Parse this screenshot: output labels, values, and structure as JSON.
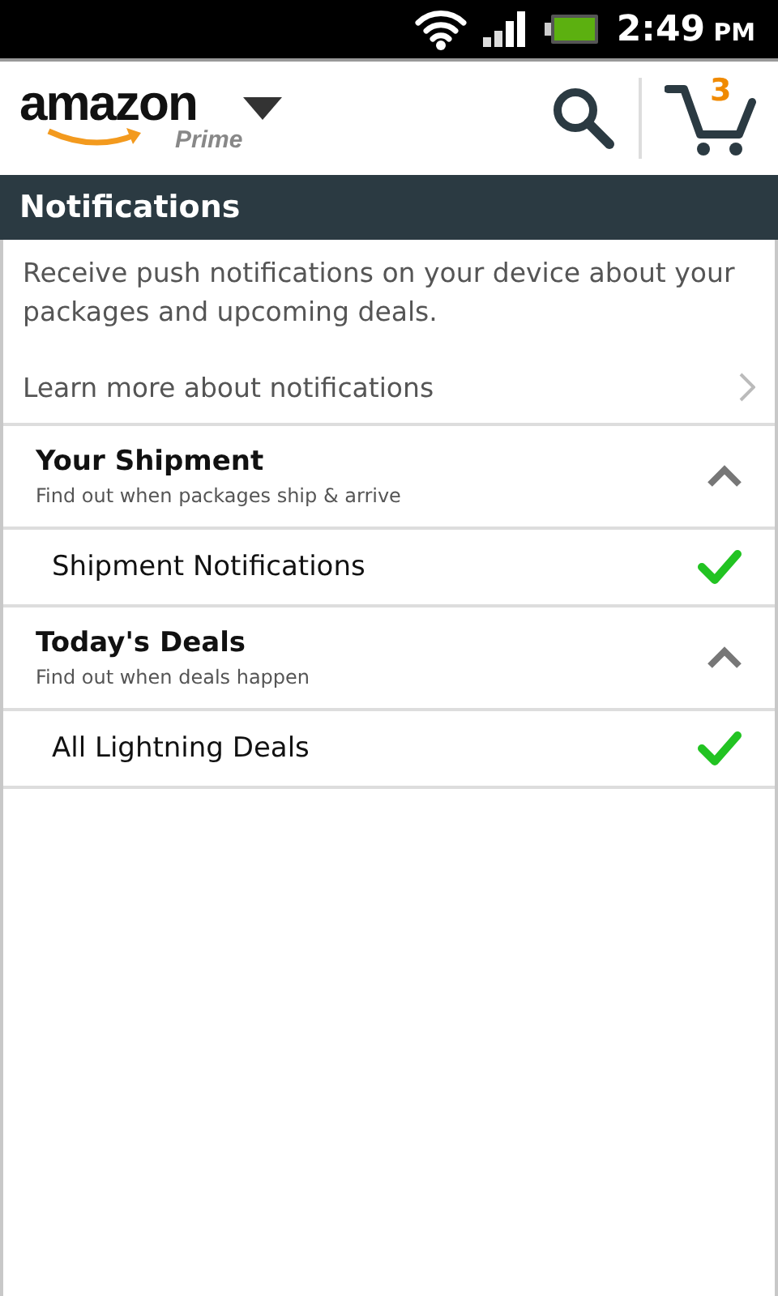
{
  "status_bar": {
    "time": "2:49",
    "ampm": "PM"
  },
  "header": {
    "logo": "amazon",
    "logo_sub": "Prime",
    "cart_count": "3"
  },
  "title": "Notifications",
  "description": "Receive push notifications on your device about your packages and upcoming deals.",
  "learn_more": "Learn more about notifications",
  "sections": [
    {
      "title": "Your Shipment",
      "subtitle": "Find out when packages ship & arrive",
      "expanded": true,
      "items": [
        {
          "label": "Shipment Notifications",
          "checked": true
        }
      ]
    },
    {
      "title": "Today's Deals",
      "subtitle": "Find out when deals happen",
      "expanded": true,
      "items": [
        {
          "label": "All Lightning Deals",
          "checked": true
        }
      ]
    }
  ]
}
